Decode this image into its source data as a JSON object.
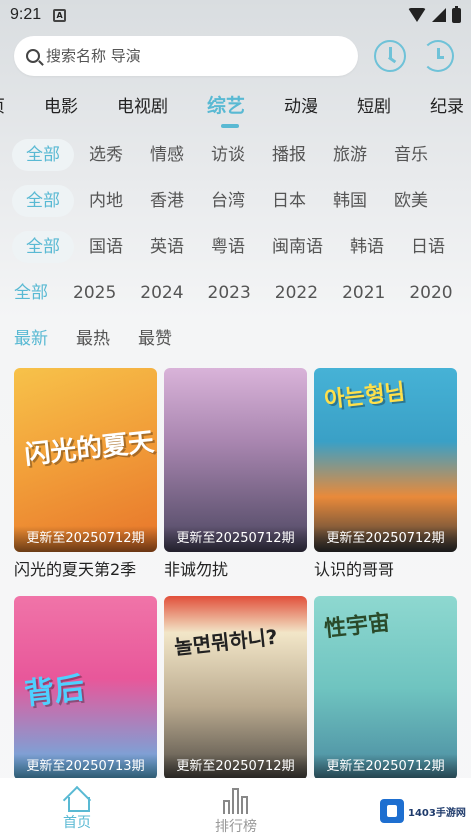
{
  "status": {
    "time": "9:21",
    "indicator": "A"
  },
  "search": {
    "placeholder": "搜索名称 导演"
  },
  "nav_tabs": [
    "页",
    "电影",
    "电视剧",
    "综艺",
    "动漫",
    "短剧",
    "纪录"
  ],
  "active_nav": "综艺",
  "filters": {
    "genre": {
      "selected": "全部",
      "options": [
        "选秀",
        "情感",
        "访谈",
        "播报",
        "旅游",
        "音乐"
      ]
    },
    "region": {
      "selected": "全部",
      "options": [
        "内地",
        "香港",
        "台湾",
        "日本",
        "韩国",
        "欧美"
      ]
    },
    "language": {
      "selected": "全部",
      "options": [
        "国语",
        "英语",
        "粤语",
        "闽南语",
        "韩语",
        "日语"
      ]
    },
    "year": {
      "selected": "全部",
      "options": [
        "2025",
        "2024",
        "2023",
        "2022",
        "2021",
        "2020"
      ]
    },
    "sort": {
      "selected": "最新",
      "options": [
        "最热",
        "最赞"
      ]
    }
  },
  "cards": [
    {
      "title": "闪光的夏天第2季",
      "badge": "更新至20250712期",
      "poster_text": "闪光的夏天",
      "colors": [
        "#f5a623",
        "#e8742a"
      ]
    },
    {
      "title": "非诚勿扰",
      "badge": "更新至20250712期",
      "poster_text": "",
      "colors": [
        "#c9a0c8",
        "#7a6b8a"
      ]
    },
    {
      "title": "认识的哥哥",
      "badge": "更新至20250712期",
      "poster_text": "아는형님",
      "colors": [
        "#3fa2c9",
        "#f07a2a"
      ]
    },
    {
      "title": "",
      "badge": "更新至20250713期",
      "poster_text": "背后",
      "colors": [
        "#f06aa0",
        "#5ab6e8"
      ]
    },
    {
      "title": "",
      "badge": "更新至20250712期",
      "poster_text": "놀면뭐하니?",
      "colors": [
        "#f2e6c8",
        "#7b6a5a"
      ]
    },
    {
      "title": "",
      "badge": "更新至20250712期",
      "poster_text": "性宇宙",
      "colors": [
        "#7fd0c8",
        "#5fa8b8"
      ]
    }
  ],
  "bottom_nav": {
    "home": "首页",
    "rank": "排行榜"
  },
  "watermark": {
    "text": "1403手游网"
  },
  "colors": {
    "accent": "#59b9d3"
  }
}
